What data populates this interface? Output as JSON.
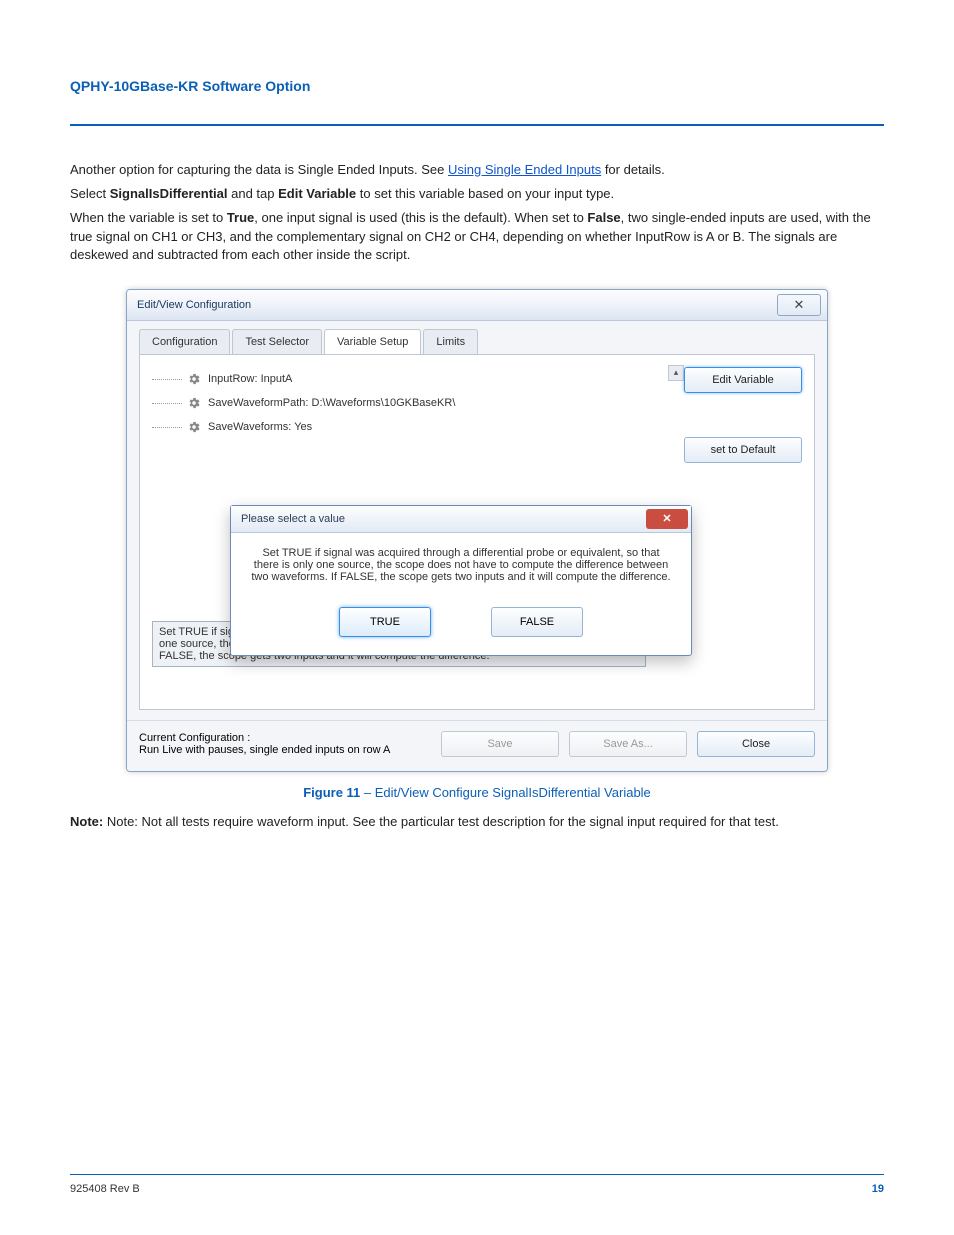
{
  "page": {
    "header_label": "QPHY-10GBase-KR Software Option",
    "footer_left": "925408 Rev B",
    "footer_right": "19"
  },
  "intro": {
    "p1": "Another option for capturing the data is Single Ended Inputs. See ",
    "p1_link": "Using Single Ended Inputs",
    "p1_tail": " for details.",
    "p2_a": "Select ",
    "p2_b": "SignalIsDifferential",
    "p2_c": " and tap ",
    "p2_d": "Edit Variable",
    "p2_e": " to set this variable based on your input type.",
    "p3_a": "When the variable is set to ",
    "p3_b": "True",
    "p3_c": ", one input signal is used (this is the default).",
    "p3_d": " When set to ",
    "p3_e": "False",
    "p3_f": ", two single-ended inputs are used, with the true signal on CH1 or CH3, and the complementary signal on CH2 or CH4, depending on whether InputRow is A or B. The signals are deskewed and subtracted from each other inside the script."
  },
  "win": {
    "title": "Edit/View Configuration",
    "tabs": {
      "t1": "Configuration",
      "t2": "Test Selector",
      "t3": "Variable Setup",
      "t4": "Limits"
    },
    "tree": {
      "i1": "InputRow: InputA",
      "i2": "SaveWaveformPath: D:\\Waveforms\\10GKBaseKR\\",
      "i3": "SaveWaveforms: Yes"
    },
    "buttons": {
      "edit": "Edit Variable",
      "reset": "set to Default"
    },
    "desc": "Set TRUE if signal was acquired through a differential probe or equivalent, so that there is only one source, the scope does not have to compute the difference between two waveforms. If FALSE, the scope gets two inputs and it will compute the difference.",
    "config_label": "Current Configuration :",
    "config_value": "Run Live with pauses, single ended inputs on row A",
    "footer_btns": {
      "save": "Save",
      "saveas": "Save As...",
      "close": "Close"
    }
  },
  "modal": {
    "title": "Please select a value",
    "body": "Set TRUE if signal was acquired through a differential probe or equivalent, so that there is only one source, the scope does not have to compute the difference between two waveforms. If FALSE, the scope gets two inputs and it will compute the difference.",
    "true": "TRUE",
    "false": "FALSE"
  },
  "caption": {
    "num": "Figure 11",
    "sep": " – ",
    "text": "Edit/View Configure SignalIsDifferential Variable"
  },
  "note": "Note: Not all tests require waveform input. See the particular test description for the signal input required for that test."
}
